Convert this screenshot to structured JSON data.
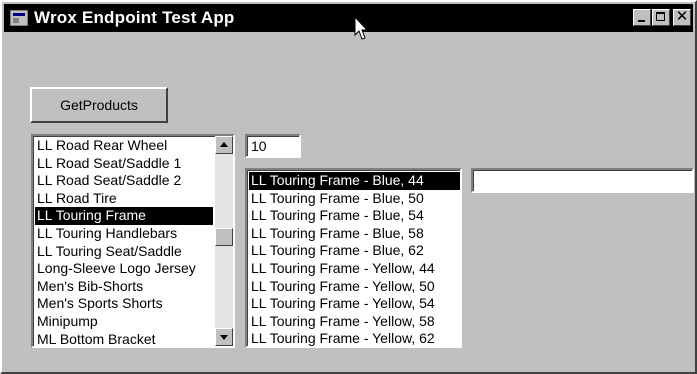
{
  "window": {
    "title": "Wrox Endpoint Test App"
  },
  "toolbar": {
    "get_products_label": "GetProducts"
  },
  "products_list": {
    "items": [
      "LL Road Rear Wheel",
      "LL Road Seat/Saddle 1",
      "LL Road Seat/Saddle 2",
      "LL Road Tire",
      "LL Touring Frame",
      "LL Touring Handlebars",
      "LL Touring Seat/Saddle",
      "Long-Sleeve Logo Jersey",
      "Men's Bib-Shorts",
      "Men's Sports Shorts",
      "Minipump",
      "ML Bottom Bracket"
    ],
    "selected_index": 4
  },
  "count_input": {
    "value": "10"
  },
  "variants_list": {
    "items": [
      "LL Touring Frame - Blue, 44",
      "LL Touring Frame - Blue, 50",
      "LL Touring Frame - Blue, 54",
      "LL Touring Frame - Blue, 58",
      "LL Touring Frame - Blue, 62",
      "LL Touring Frame - Yellow, 44",
      "LL Touring Frame - Yellow, 50",
      "LL Touring Frame - Yellow, 54",
      "LL Touring Frame - Yellow, 58",
      "LL Touring Frame - Yellow, 62"
    ],
    "selected_index": 0
  },
  "detail_input": {
    "value": ""
  },
  "colors": {
    "titlebar": "#000000",
    "face": "#c0c0c0",
    "selection": "#000000"
  }
}
